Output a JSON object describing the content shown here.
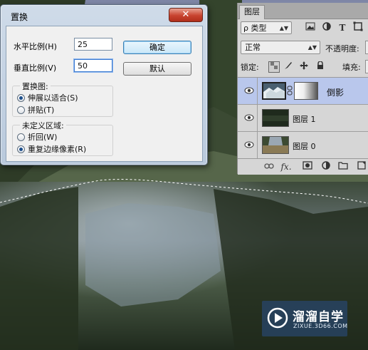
{
  "dialog": {
    "title": "置换",
    "close_label": "✕",
    "horizontal_scale_label": "水平比例(H)",
    "horizontal_scale_value": "25",
    "vertical_scale_label": "垂直比例(V)",
    "vertical_scale_value": "50",
    "ok_label": "确定",
    "default_label": "默认",
    "displacement_map": {
      "title": "置换图:",
      "options": [
        "伸展以适合(S)",
        "拼贴(T)"
      ],
      "selected": 0
    },
    "undefined_areas": {
      "title": "未定义区域:",
      "options": [
        "折回(W)",
        "重复边缘像素(R)"
      ],
      "selected": 1
    }
  },
  "layers_panel": {
    "tab_label": "图层",
    "filter_label": "ρ 类型",
    "filter_icons": [
      "image-filter-icon",
      "adjustment-filter-icon",
      "type-filter-icon",
      "shape-filter-icon"
    ],
    "type_icon_glyph": "T",
    "blend_mode": "正常",
    "opacity_label": "不透明度:",
    "lock_label": "锁定:",
    "fill_label": "填充:",
    "layers": [
      {
        "name": "倒影",
        "selected": true,
        "has_mask": true
      },
      {
        "name": "图层 1",
        "selected": false,
        "has_mask": false
      },
      {
        "name": "图层 0",
        "selected": false,
        "has_mask": false
      }
    ],
    "footer_fx_label": "fx."
  },
  "watermark": {
    "brand": "溜溜自学",
    "url": "ZIXUE.3D66.COM"
  }
}
